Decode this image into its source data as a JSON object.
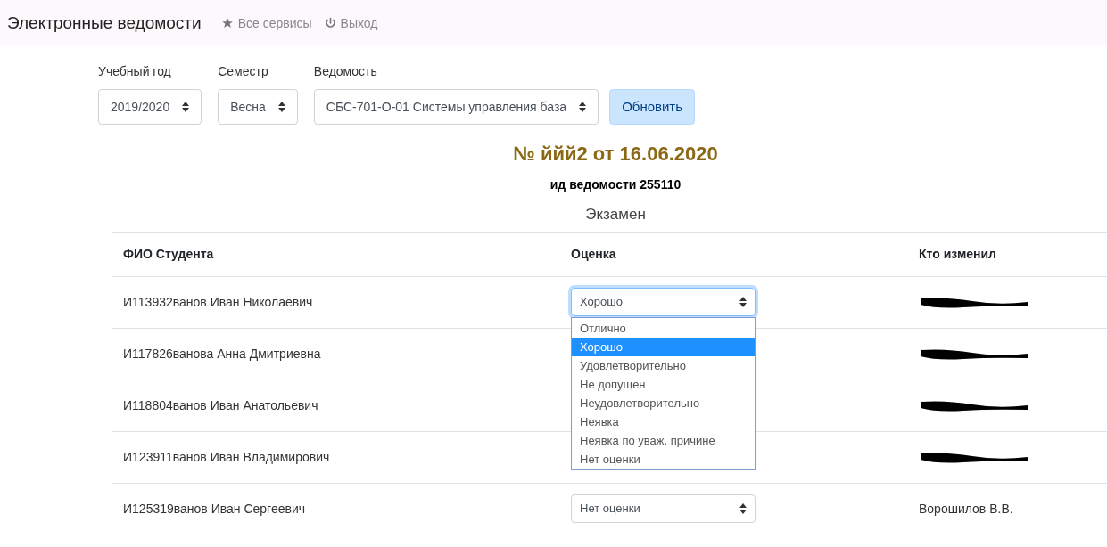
{
  "navbar": {
    "brand": "Электронные ведомости",
    "links": [
      {
        "kind": "star",
        "label": "Все сервисы"
      },
      {
        "kind": "power",
        "label": "Выход"
      }
    ]
  },
  "filters": [
    {
      "label": "Учебный год",
      "value": "2019/2020"
    },
    {
      "label": "Семестр",
      "value": "Весна"
    },
    {
      "label": "Ведомость",
      "value": "СБС-701-О-01 Системы управления база"
    }
  ],
  "refresh_button": "Обновить",
  "sheet": {
    "title": "№ ййй2 от 16.06.2020",
    "id_line": "ид ведомости 255110",
    "type": "Экзамен"
  },
  "table": {
    "columns": [
      "ФИО Студента",
      "Оценка",
      "Кто изменил"
    ],
    "rows": [
      {
        "name": "И113932ванов Иван Николаевич",
        "grade": "Хорошо",
        "changed_by": {
          "kind": "redacted"
        },
        "expanded": true
      },
      {
        "name": "И117826ванова Анна Дмитриевна",
        "changed_by": {
          "kind": "redacted"
        },
        "expanded": false
      },
      {
        "name": "И118804ванов Иван Анатольевич",
        "changed_by": {
          "kind": "redacted"
        },
        "expanded": false
      },
      {
        "name": "И123911ванов Иван Владимирович",
        "changed_by": {
          "kind": "redacted"
        },
        "expanded": false
      },
      {
        "name": "И125319ванов Иван Сергеевич",
        "grade": "Нет оценки",
        "changed_by": {
          "kind": "text",
          "text": "Ворошилов В.В."
        },
        "expanded": false
      }
    ]
  },
  "grade_options": [
    {
      "label": "Отлично",
      "selected": false
    },
    {
      "label": "Хорошо",
      "selected": true
    },
    {
      "label": "Удовлетворительно",
      "selected": false
    },
    {
      "label": "Не допущен",
      "selected": false
    },
    {
      "label": "Неудовлетворительно",
      "selected": false
    },
    {
      "label": "Неявка",
      "selected": false
    },
    {
      "label": "Неявка по уваж. причине",
      "selected": false
    },
    {
      "label": "Нет оценки",
      "selected": false
    }
  ]
}
